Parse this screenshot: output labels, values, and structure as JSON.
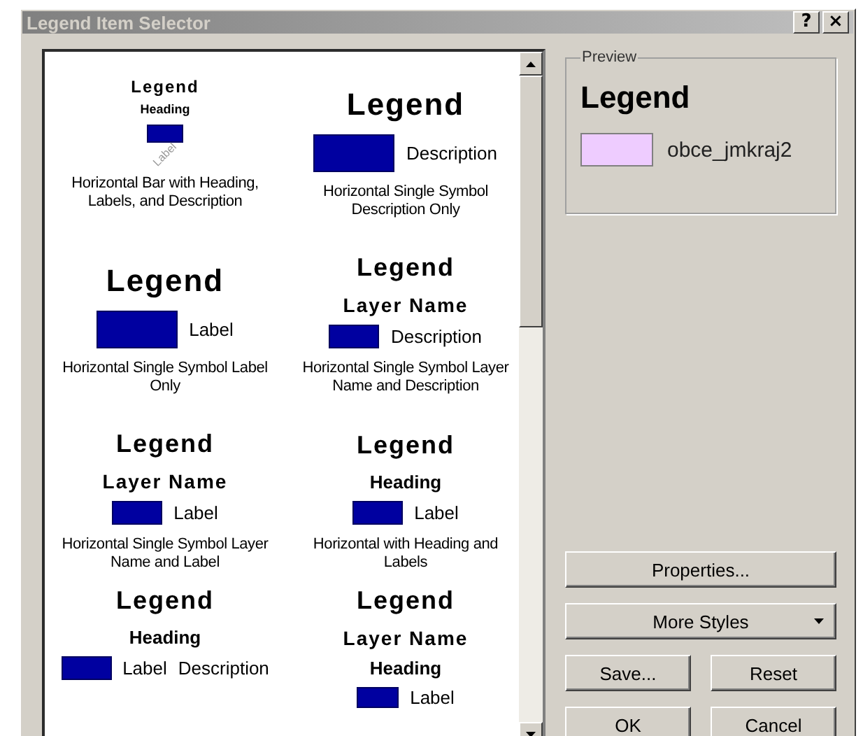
{
  "window": {
    "title": "Legend Item Selector",
    "help_button": "?",
    "close_button": "×"
  },
  "styles": [
    {
      "kind": "rotated",
      "selected": false,
      "title": "Legend",
      "heading": "Heading",
      "labels": [
        "Label"
      ],
      "caption": "Horizontal Bar with Heading, Labels, and Description"
    },
    {
      "kind": "inline",
      "selected": false,
      "title": "Legend",
      "labels": [
        "Description"
      ],
      "caption": "Horizontal Single Symbol Description Only"
    },
    {
      "kind": "inline",
      "selected": false,
      "title": "Legend",
      "labels": [
        "Label"
      ],
      "caption": "Horizontal Single Symbol Label Only"
    },
    {
      "kind": "inline",
      "selected": false,
      "title": "Legend",
      "layer": "Layer Name",
      "labels": [
        "Description"
      ],
      "caption": "Horizontal Single Symbol Layer Name and Description"
    },
    {
      "kind": "inline",
      "selected": false,
      "title": "Legend",
      "layer": "Layer Name",
      "labels": [
        "Label"
      ],
      "caption": "Horizontal Single Symbol Layer Name and Label"
    },
    {
      "kind": "inline",
      "selected": false,
      "title": "Legend",
      "heading": "Heading",
      "labels": [
        "Label"
      ],
      "caption": "Horizontal with Heading and Labels"
    },
    {
      "kind": "inline",
      "selected": false,
      "title": "Legend",
      "heading": "Heading",
      "labels": [
        "Label",
        "Description"
      ]
    },
    {
      "kind": "inline",
      "selected": false,
      "title": "Legend",
      "layer": "Layer Name",
      "heading": "Heading",
      "labels": [
        "Label"
      ]
    }
  ],
  "preview": {
    "label": "Preview",
    "title": "Legend",
    "layer": "obce_jmkraj2"
  },
  "buttons": {
    "properties": "Properties...",
    "more_styles": "More Styles",
    "save": "Save...",
    "reset": "Reset",
    "ok": "OK",
    "cancel": "Cancel"
  }
}
